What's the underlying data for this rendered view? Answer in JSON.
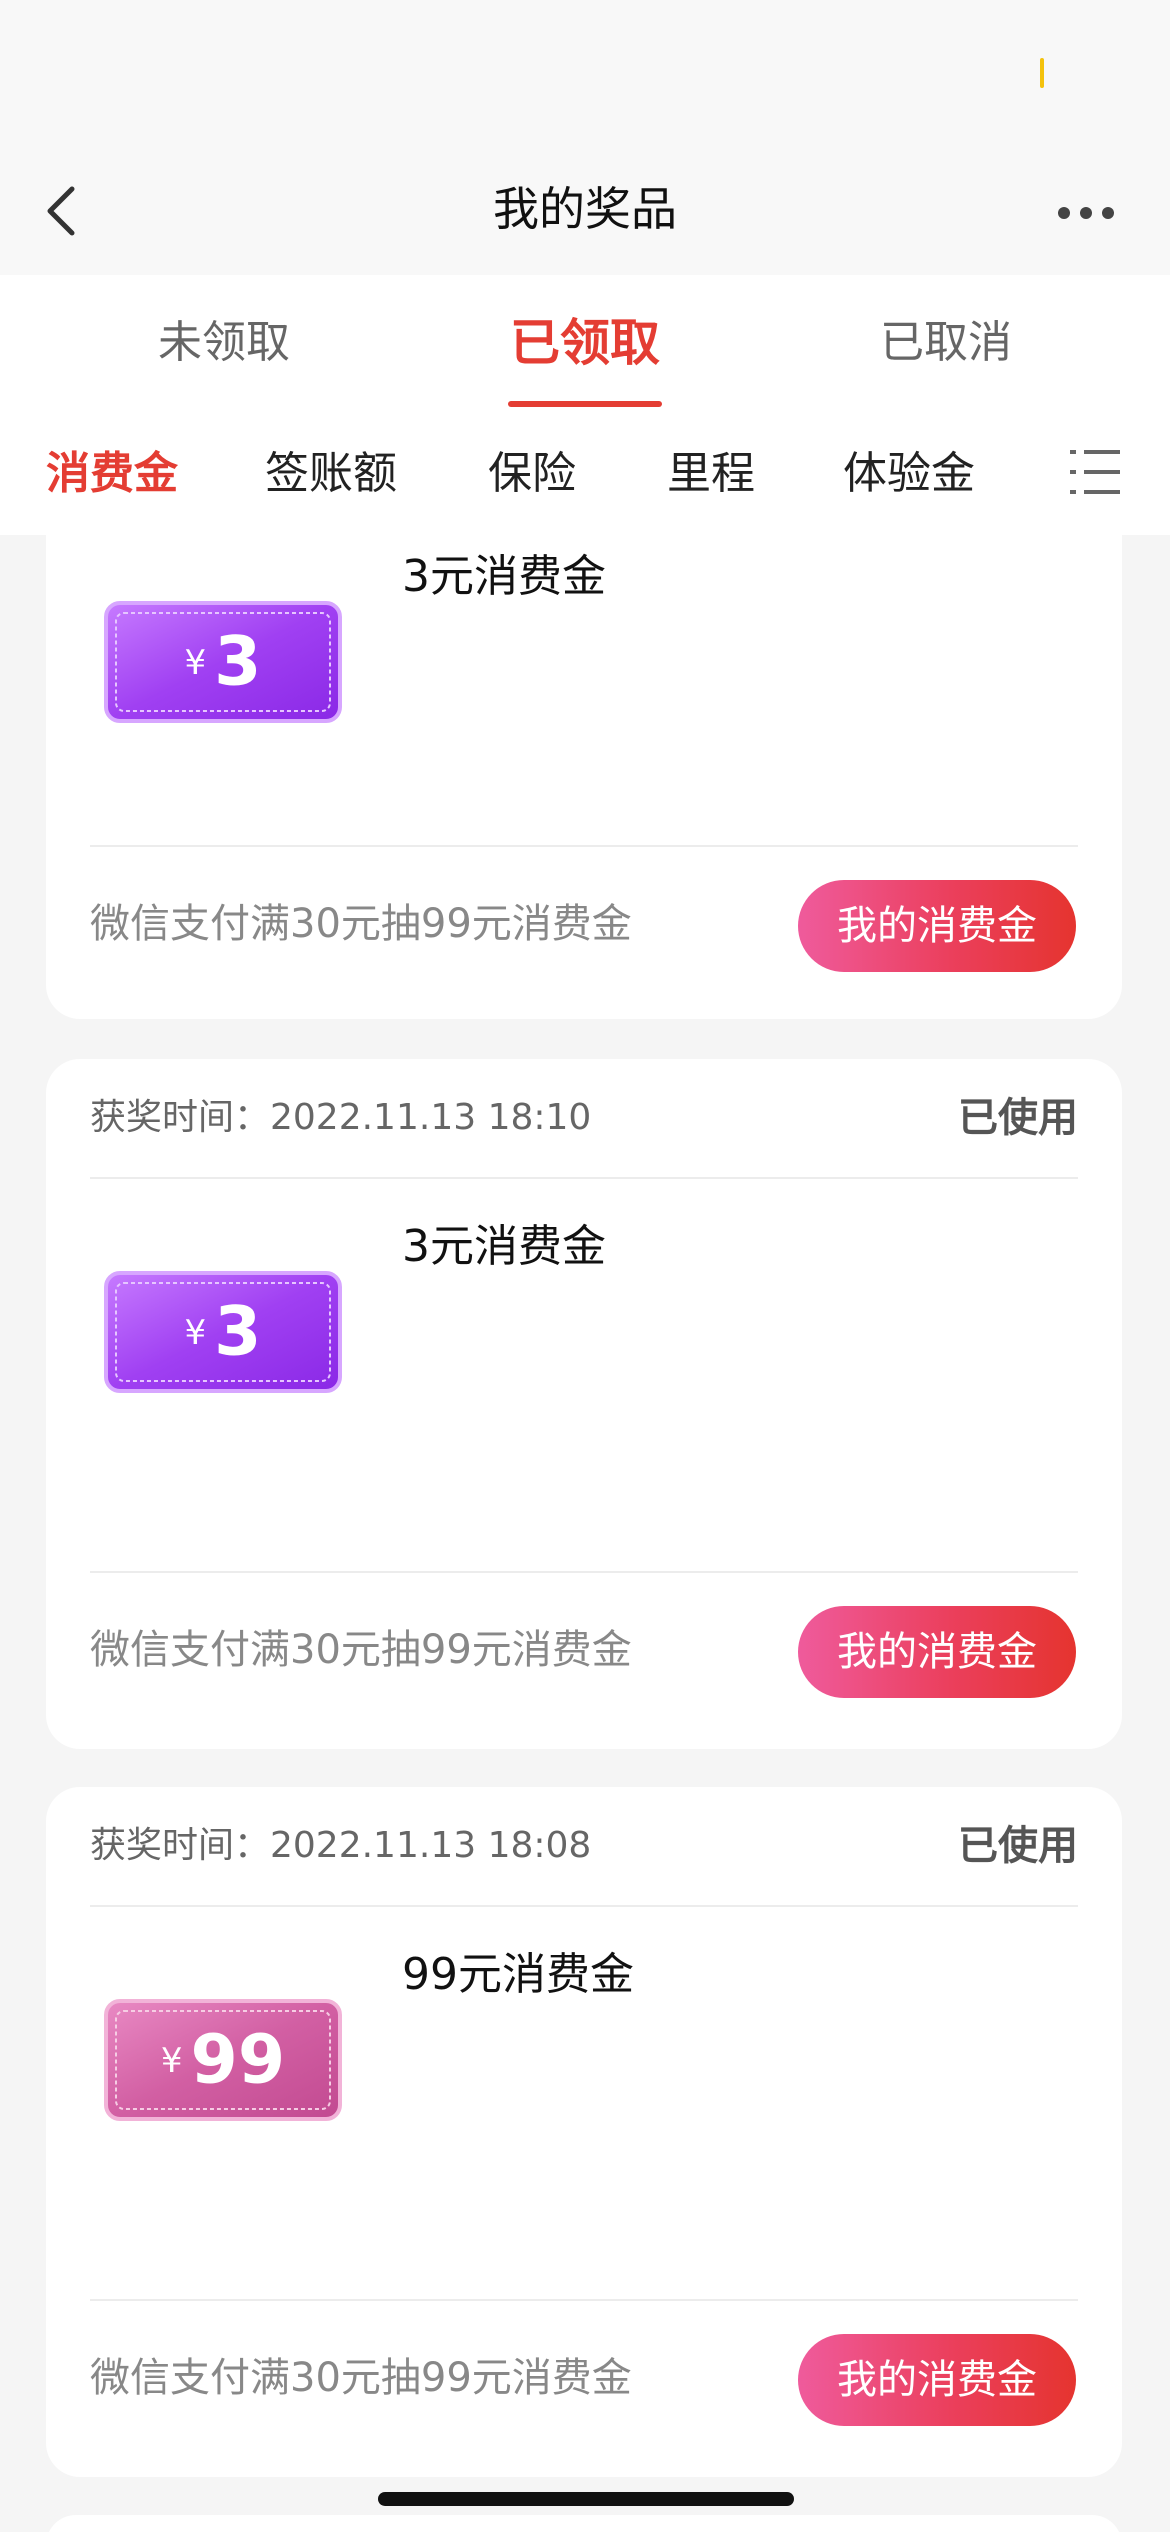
{
  "nav": {
    "title": "我的奖品"
  },
  "status_tabs": [
    {
      "label": "未领取"
    },
    {
      "label": "已领取"
    },
    {
      "label": "已取消"
    }
  ],
  "categories": [
    {
      "label": "消费金"
    },
    {
      "label": "签账额"
    },
    {
      "label": "保险"
    },
    {
      "label": "里程"
    },
    {
      "label": "体验金"
    }
  ],
  "cards": [
    {
      "prize_name": "3元消费金",
      "ticket_currency": "¥",
      "ticket_amount": "3",
      "ticket_color": "#9b3cf0",
      "promo": "微信支付满30元抽99元消费金",
      "button": "我的消费金"
    },
    {
      "award_time": "获奖时间：2022.11.13 18:10",
      "status": "已使用",
      "prize_name": "3元消费金",
      "ticket_currency": "¥",
      "ticket_amount": "3",
      "ticket_color": "#9b3cf0",
      "promo": "微信支付满30元抽99元消费金",
      "button": "我的消费金"
    },
    {
      "award_time": "获奖时间：2022.11.13 18:08",
      "status": "已使用",
      "prize_name": "99元消费金",
      "ticket_currency": "¥",
      "ticket_amount": "99",
      "ticket_color": "#d0559b",
      "promo": "微信支付满30元抽99元消费金",
      "button": "我的消费金"
    }
  ],
  "colors": {
    "accent": "#e43d33",
    "button_start": "#ef5b9c",
    "button_end": "#e5342f"
  }
}
